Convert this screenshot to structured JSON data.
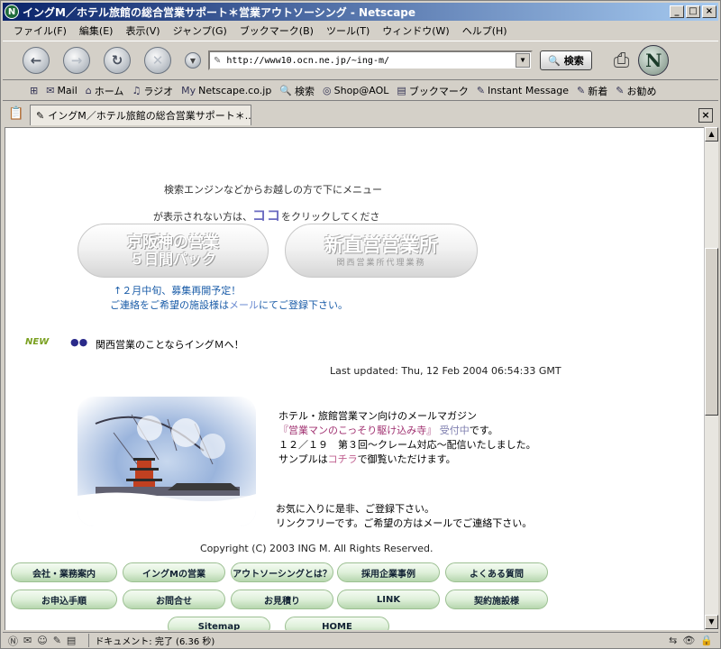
{
  "window": {
    "title": "イングM／ホテル旅館の総合営業サポート＊営業アウトソーシング - Netscape",
    "minimize": "_",
    "maximize": "□",
    "close": "×"
  },
  "menu": [
    "ファイル(F)",
    "編集(E)",
    "表示(V)",
    "ジャンプ(G)",
    "ブックマーク(B)",
    "ツール(T)",
    "ウィンドウ(W)",
    "ヘルプ(H)"
  ],
  "nav": {
    "back": "←",
    "forward": "→",
    "reload": "↻",
    "stop": "✕",
    "url": "http://www10.ocn.ne.jp/~ing-m/",
    "search_label": "検索",
    "logo": "N"
  },
  "bookmarks": [
    {
      "icon": "⊞",
      "label": ""
    },
    {
      "icon": "✉",
      "label": "Mail"
    },
    {
      "icon": "⌂",
      "label": "ホーム"
    },
    {
      "icon": "♫",
      "label": "ラジオ"
    },
    {
      "icon": "My",
      "label": "Netscape.co.jp"
    },
    {
      "icon": "🔍",
      "label": "検索"
    },
    {
      "icon": "◎",
      "label": "Shop@AOL"
    },
    {
      "icon": "▤",
      "label": "ブックマーク"
    },
    {
      "icon": "✎",
      "label": "Instant Message"
    },
    {
      "icon": "✎",
      "label": "新着"
    },
    {
      "icon": "✎",
      "label": "お勧め"
    }
  ],
  "tab": {
    "title": "イングM／ホテル旅館の総合営業サポート＊..."
  },
  "page": {
    "intro_line1": "検索エンジンなどからお越しの方で下にメニュー",
    "intro_line2_pre": "が表示されない方は、",
    "intro_koko": "ココ",
    "intro_line2_post": "をクリックしてくださ",
    "btn1_line1": "京阪神の営業",
    "btn1_line2": "５日間パック",
    "btn2_line1": "新直営営業所",
    "btn2_sub": "関西営業所代理業務",
    "note1": "↑２月中旬、募集再開予定！",
    "note2_pre": "ご連絡をご希望の施設様は",
    "note2_mail": "メール",
    "note2_post": "にてご登録下さい。",
    "new_badge": "NEW",
    "bullets": "●●",
    "new_text": "関西営業のことならイングＭへ！",
    "last_updated": "Last updated: Thu, 12 Feb 2004 06:54:33 GMT",
    "mag_line1": "ホテル・旅館営業マン向けのメールマガジン",
    "mag_line2_title": "『営業マンのこっそり駆け込み寺』",
    "mag_line2_status": "受付中",
    "mag_line2_post": "です。",
    "mag_line3": "１２／１９　第３回～クレーム対応～配信いたしました。",
    "mag_line4_pre": "サンプルは",
    "mag_line4_link": "コチラ",
    "mag_line4_post": "で御覧いただけます。",
    "fav_line1": "お気に入りに是非、ご登録下さい。",
    "fav_line2": "リンクフリーです。ご希望の方はメールでご連絡下さい。",
    "copyright": "Copyright (C) 2003 ING M. All Rights Reserved."
  },
  "site_nav": [
    "会社・業務案内",
    "イングMの営業",
    "アウトソーシングとは？",
    "採用企業事例",
    "よくある質問",
    "お申込手順",
    "お問合せ",
    "お見積り",
    "LINK",
    "契約施設様",
    "Sitemap",
    "HOME"
  ],
  "status": {
    "text": "ドキュメント: 完了 (6.36 秒)"
  }
}
